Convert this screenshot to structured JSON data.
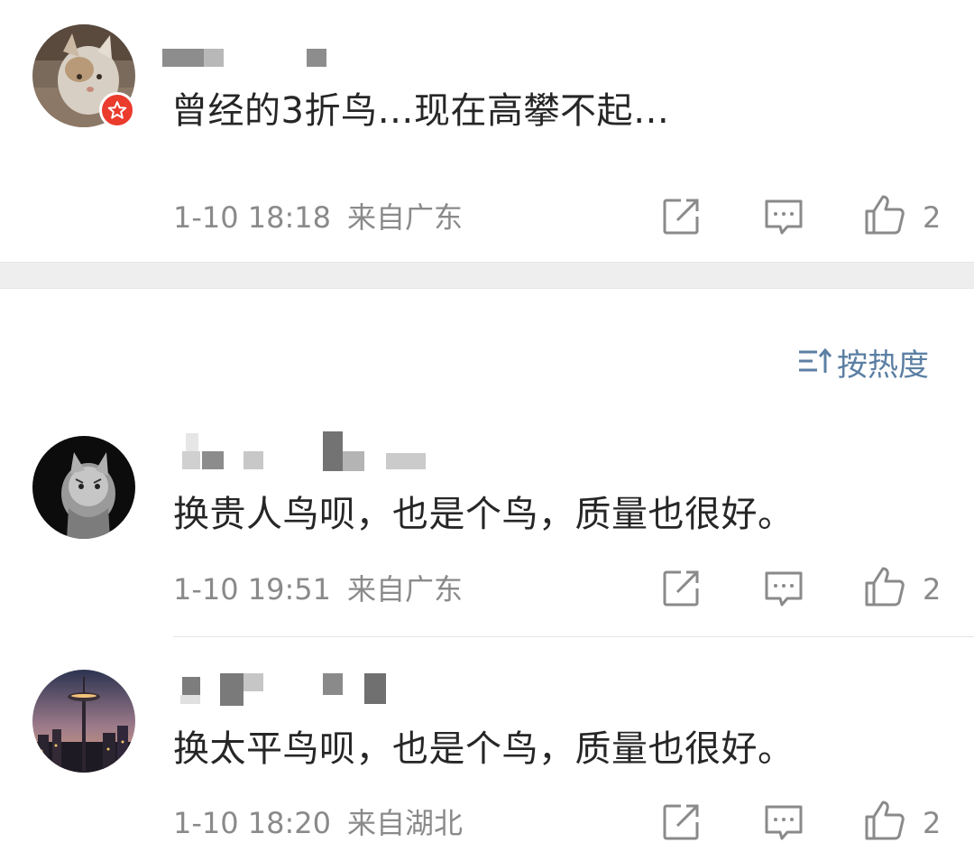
{
  "sort": {
    "label": "按热度",
    "icon": "sort-icon",
    "color": "#5b7fa3"
  },
  "comments": [
    {
      "text": "曾经的3折鸟…现在高攀不起…",
      "date": "1-10 18:18",
      "location": "来自广东",
      "likes": "2",
      "verified": true,
      "username_blurred": true
    },
    {
      "text": "换贵人鸟呗，也是个鸟，质量也很好。",
      "date": "1-10 19:51",
      "location": "来自广东",
      "likes": "2",
      "verified": false,
      "username_blurred": true
    },
    {
      "text": "换太平鸟呗，也是个鸟，质量也很好。",
      "date": "1-10 18:20",
      "location": "来自湖北",
      "likes": "2",
      "verified": false,
      "username_blurred": true
    }
  ],
  "icons": {
    "share": "share-icon",
    "reply": "reply-icon",
    "like": "thumbs-up-icon",
    "badge": "verified-star-icon"
  },
  "colors": {
    "text": "#262626",
    "meta": "#8a8a8a",
    "badge": "#ea3b2d",
    "divider": "#eeeeee"
  }
}
